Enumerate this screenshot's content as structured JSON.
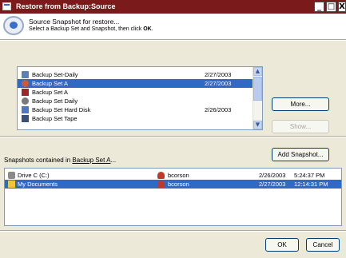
{
  "window": {
    "title": "Restore from Backup:Source"
  },
  "title_buttons": {
    "minimize": "_",
    "maximize": "□",
    "close": "X"
  },
  "header": {
    "title": "Source Snapshot for restore...",
    "subtitle_prefix": "Select a Backup Set and Snapshot, then click ",
    "subtitle_bold": "OK",
    "subtitle_suffix": "."
  },
  "backup_sets": [
    {
      "name": "Backup Set-Daily",
      "date": "2/27/2003",
      "icon": "drive-icon",
      "selected": false
    },
    {
      "name": "Backup Set A",
      "date": "2/27/2003",
      "icon": "backup-set-icon",
      "selected": true
    },
    {
      "name": "Backup Set A",
      "date": "",
      "icon": "backup-set-red-icon",
      "selected": false
    },
    {
      "name": "Backup Set Daily",
      "date": "",
      "icon": "backup-set-gray-icon",
      "selected": false
    },
    {
      "name": "Backup Set Hard Disk",
      "date": "2/26/2003",
      "icon": "hard-disk-icon",
      "selected": false
    },
    {
      "name": "Backup Set Tape",
      "date": "",
      "icon": "tape-icon",
      "selected": false
    }
  ],
  "buttons": {
    "more": "More...",
    "show": "Show...",
    "add_snapshot": "Add Snapshot...",
    "ok": "OK",
    "cancel": "Cancel"
  },
  "snapshots_label": {
    "prefix": "Snapshots contained in ",
    "set_name": "Backup Set A",
    "suffix": "..."
  },
  "snapshots": [
    {
      "name": "Drive C (C:)",
      "user": "bcorson",
      "date": "2/26/2003",
      "time": "5:24:37 PM",
      "icon": "disk-drive-icon",
      "selected": false
    },
    {
      "name": "My Documents",
      "user": "bcorson",
      "date": "2/27/2003",
      "time": "12:14:31 PM",
      "icon": "folder-icon",
      "selected": true
    }
  ],
  "colors": {
    "titlebar": "#7b1a1a",
    "selection": "#316ac5",
    "dialog_bg": "#ece9d8"
  }
}
